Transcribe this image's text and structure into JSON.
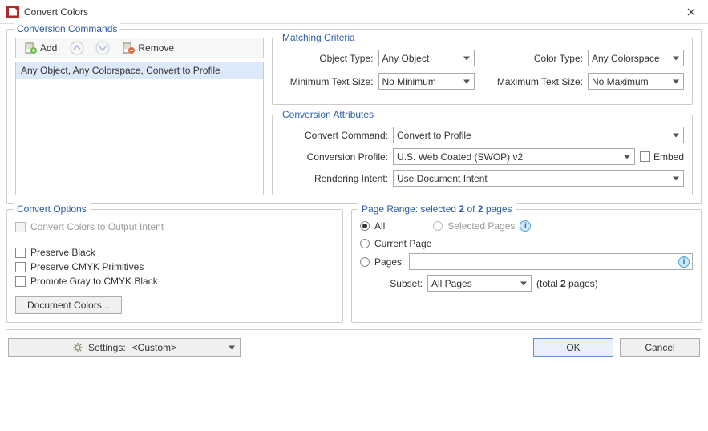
{
  "window": {
    "title": "Convert Colors"
  },
  "commands": {
    "legend": "Conversion Commands",
    "toolbar": {
      "add": "Add",
      "remove": "Remove"
    },
    "items": [
      "Any Object, Any Colorspace, Convert to Profile"
    ]
  },
  "matching": {
    "legend": "Matching Criteria",
    "objectTypeLabel": "Object Type:",
    "objectType": "Any Object",
    "colorTypeLabel": "Color Type:",
    "colorType": "Any Colorspace",
    "minTextLabel": "Minimum Text Size:",
    "minText": "No Minimum",
    "maxTextLabel": "Maximum Text Size:",
    "maxText": "No Maximum"
  },
  "conversion": {
    "legend": "Conversion Attributes",
    "commandLabel": "Convert Command:",
    "command": "Convert to Profile",
    "profileLabel": "Conversion Profile:",
    "profile": "U.S. Web Coated (SWOP) v2",
    "embedLabel": "Embed",
    "intentLabel": "Rendering Intent:",
    "intent": "Use Document Intent"
  },
  "options": {
    "legend": "Convert Options",
    "outputIntent": "Convert Colors to Output Intent",
    "preserveBlack": "Preserve Black",
    "preserveCmyk": "Preserve CMYK Primitives",
    "promoteGray": "Promote Gray to CMYK Black",
    "documentColors": "Document Colors..."
  },
  "pageRange": {
    "legendPrefix": "Page Range: selected ",
    "selCount": "2",
    "legendMid": " of ",
    "totalCount": "2",
    "legendSuffix": " pages",
    "all": "All",
    "selectedPages": "Selected Pages",
    "currentPage": "Current Page",
    "pages": "Pages:",
    "subsetLabel": "Subset:",
    "subset": "All Pages",
    "totalPrefix": "(total ",
    "totalSuffix": " pages)"
  },
  "footer": {
    "settingsLabel": "Settings:",
    "settingsValue": "<Custom>",
    "ok": "OK",
    "cancel": "Cancel"
  }
}
